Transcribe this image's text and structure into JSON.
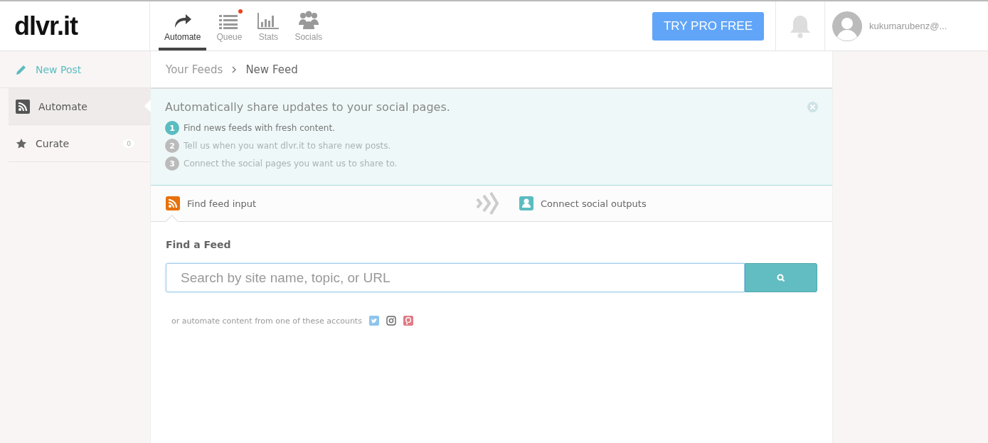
{
  "logo": "dlvr.it",
  "nav": [
    {
      "label": "Automate",
      "selected": true,
      "notification": false
    },
    {
      "label": "Queue",
      "selected": false,
      "notification": true
    },
    {
      "label": "Stats",
      "selected": false,
      "notification": false
    },
    {
      "label": "Socials",
      "selected": false,
      "notification": false
    }
  ],
  "pro_button": "TRY PRO FREE",
  "user": {
    "email": "kukumarubenz@..."
  },
  "sidebar": {
    "items": [
      {
        "label": "New Post",
        "kind": "action",
        "selected": false
      },
      {
        "label": "Automate",
        "kind": "link",
        "selected": true
      },
      {
        "label": "Curate",
        "kind": "link",
        "selected": false,
        "count": "0"
      }
    ]
  },
  "breadcrumb": [
    "Your Feeds",
    "New Feed"
  ],
  "intro": {
    "title": "Automatically share updates to your social pages.",
    "steps": [
      {
        "number": "1",
        "text": "Find news feeds with fresh content.",
        "active": true
      },
      {
        "number": "2",
        "text": "Tell us when you want dlvr.it to share new posts.",
        "active": false
      },
      {
        "number": "3",
        "text": "Connect the social pages you want us to share to.",
        "active": false
      }
    ]
  },
  "flow": [
    {
      "label": "Find feed input",
      "selected": true
    },
    {
      "label": "Connect social outputs",
      "selected": false
    }
  ],
  "find": {
    "heading": "Find a Feed",
    "placeholder": "Search by site name, topic, or URL",
    "accounts_text": "or automate content from one of these accounts"
  }
}
